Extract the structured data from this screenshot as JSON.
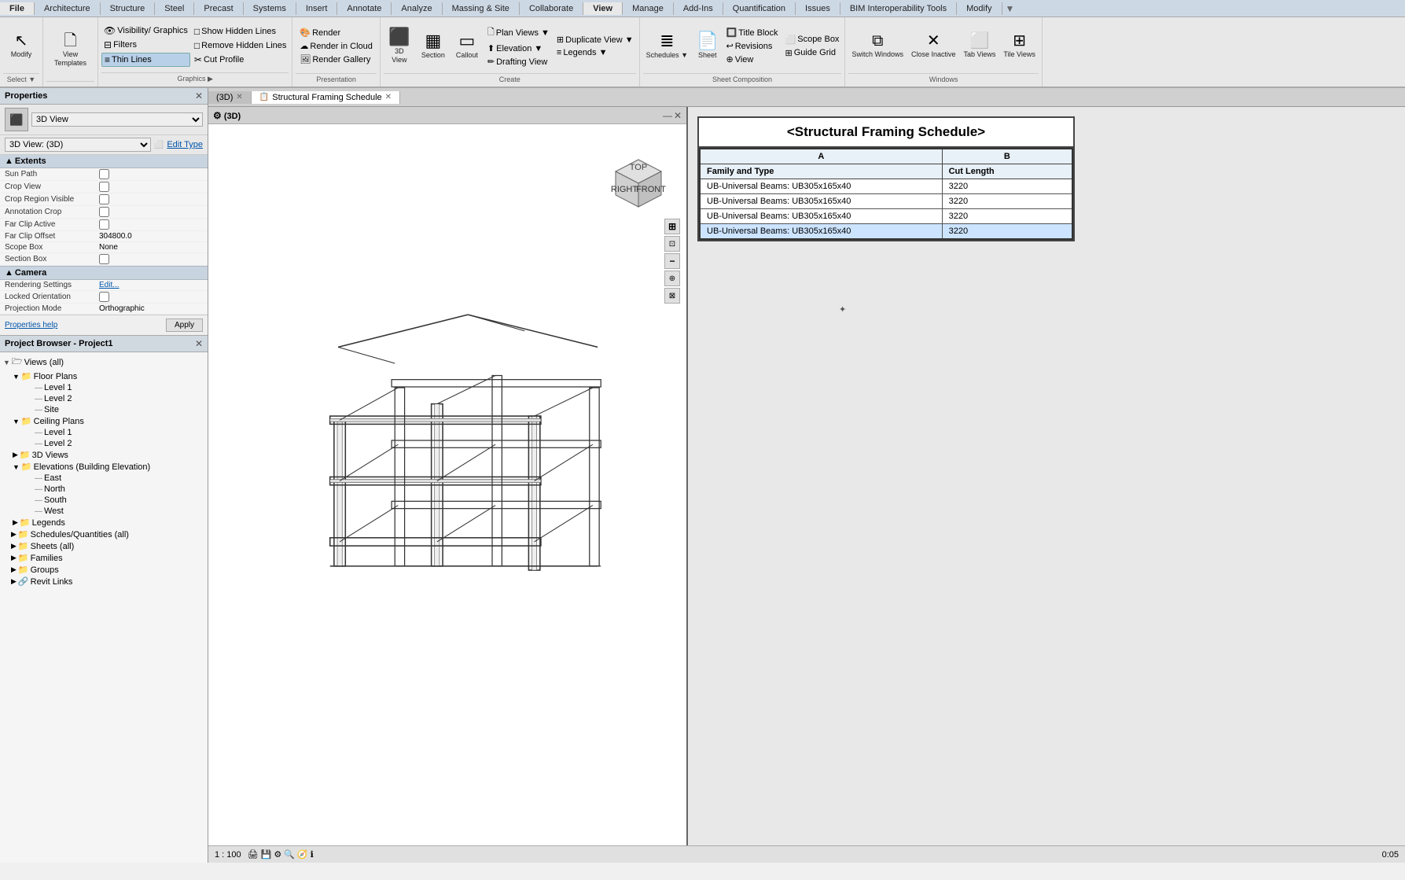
{
  "ribbon": {
    "tabs": [
      "File",
      "Architecture",
      "Structure",
      "Steel",
      "Precast",
      "Systems",
      "Insert",
      "Annotate",
      "Analyze",
      "Massing & Site",
      "Collaborate",
      "View",
      "Manage",
      "Add-Ins",
      "Quantification",
      "Issues",
      "BIM Interoperability Tools",
      "Modify"
    ],
    "active_tab": "View",
    "groups": {
      "graphics": {
        "label": "Graphics",
        "buttons": [
          {
            "id": "visibility-graphics",
            "icon": "👁",
            "label": "Visibility/\nGraphics"
          },
          {
            "id": "filters",
            "icon": "⊟",
            "label": "Filters"
          },
          {
            "id": "thin-lines",
            "icon": "⟺",
            "label": "Thin Lines"
          },
          {
            "id": "show-hidden",
            "icon": "□",
            "label": "Show Hidden Lines"
          },
          {
            "id": "remove-hidden",
            "icon": "□",
            "label": "Remove Hidden Lines"
          },
          {
            "id": "cut-profile",
            "icon": "✂",
            "label": "Cut Profile"
          }
        ]
      },
      "presentation": {
        "label": "Presentation",
        "buttons": [
          {
            "id": "render",
            "icon": "🎨",
            "label": "Render"
          },
          {
            "id": "render-cloud",
            "icon": "☁",
            "label": "Render in Cloud"
          },
          {
            "id": "render-gallery",
            "icon": "🖼",
            "label": "Render Gallery"
          }
        ]
      },
      "create": {
        "label": "Create",
        "buttons": [
          {
            "id": "3d-view",
            "icon": "⬛",
            "label": "3D\nView"
          },
          {
            "id": "section",
            "icon": "▦",
            "label": "Section"
          },
          {
            "id": "callout",
            "icon": "▭",
            "label": "Callout"
          },
          {
            "id": "plan-views",
            "icon": "🗋",
            "label": "Plan Views"
          },
          {
            "id": "elevation",
            "icon": "⬆",
            "label": "Elevation"
          },
          {
            "id": "drafting-view",
            "icon": "✏",
            "label": "Drafting View"
          },
          {
            "id": "duplicate-view",
            "icon": "⊞",
            "label": "Duplicate View"
          },
          {
            "id": "legends",
            "icon": "≡",
            "label": "Legends"
          }
        ]
      },
      "sheet-composition": {
        "label": "Sheet Composition",
        "buttons": [
          {
            "id": "schedules",
            "icon": "≣",
            "label": "Schedules"
          },
          {
            "id": "sheet",
            "icon": "📄",
            "label": "Sheet"
          },
          {
            "id": "title-block",
            "icon": "🔲",
            "label": "Title\nBlock"
          },
          {
            "id": "revisions",
            "icon": "↩",
            "label": "Revisions"
          },
          {
            "id": "view-reference",
            "icon": "⊕",
            "label": "View"
          },
          {
            "id": "guide-grid",
            "icon": "⊞",
            "label": "Guide Grid"
          },
          {
            "id": "scope-box",
            "icon": "⬜",
            "label": "Scope Box"
          }
        ]
      },
      "windows": {
        "label": "Windows",
        "buttons": [
          {
            "id": "switch-windows",
            "icon": "⧉",
            "label": "Switch Windows"
          },
          {
            "id": "close-inactive",
            "icon": "✕",
            "label": "Close Inactive"
          },
          {
            "id": "tab-views",
            "icon": "⬜",
            "label": "Tab Views"
          },
          {
            "id": "tile-views",
            "icon": "⊞",
            "label": "Tile Views"
          }
        ]
      }
    }
  },
  "properties_panel": {
    "title": "Properties",
    "view_type": "3D View",
    "view_name": "3D View: (3D)",
    "edit_type_label": "Edit Type",
    "sections": {
      "extents": {
        "label": "Extents",
        "properties": [
          {
            "label": "Sun Path",
            "value": "",
            "type": "checkbox",
            "checked": false
          },
          {
            "label": "Crop View",
            "value": "",
            "type": "checkbox",
            "checked": false
          },
          {
            "label": "Crop Region Visible",
            "value": "",
            "type": "checkbox",
            "checked": false
          },
          {
            "label": "Annotation Crop",
            "value": "",
            "type": "checkbox",
            "checked": false
          },
          {
            "label": "Far Clip Active",
            "value": "",
            "type": "checkbox",
            "checked": false
          },
          {
            "label": "Far Clip Offset",
            "value": "304800.0"
          },
          {
            "label": "Scope Box",
            "value": "None"
          },
          {
            "label": "Section Box",
            "value": "",
            "type": "checkbox",
            "checked": false
          }
        ]
      },
      "camera": {
        "label": "Camera",
        "properties": [
          {
            "label": "Rendering Settings",
            "value": "Edit...",
            "type": "link"
          },
          {
            "label": "Locked Orientation",
            "value": "",
            "type": "checkbox",
            "checked": false
          },
          {
            "label": "Projection Mode",
            "value": "Orthographic"
          }
        ]
      }
    },
    "properties_help": "Properties help",
    "apply_label": "Apply"
  },
  "project_browser": {
    "title": "Project Browser - Project1",
    "tree": [
      {
        "label": "Views (all)",
        "level": 0,
        "type": "folder",
        "expanded": true
      },
      {
        "label": "Floor Plans",
        "level": 1,
        "type": "folder",
        "expanded": true
      },
      {
        "label": "Level 1",
        "level": 2,
        "type": "view"
      },
      {
        "label": "Level 2",
        "level": 2,
        "type": "view"
      },
      {
        "label": "Site",
        "level": 2,
        "type": "view"
      },
      {
        "label": "Ceiling Plans",
        "level": 1,
        "type": "folder",
        "expanded": true
      },
      {
        "label": "Level 1",
        "level": 2,
        "type": "view"
      },
      {
        "label": "Level 2",
        "level": 2,
        "type": "view"
      },
      {
        "label": "3D Views",
        "level": 1,
        "type": "folder",
        "expanded": false
      },
      {
        "label": "Elevations (Building Elevation)",
        "level": 1,
        "type": "folder",
        "expanded": true
      },
      {
        "label": "East",
        "level": 2,
        "type": "view"
      },
      {
        "label": "North",
        "level": 2,
        "type": "view"
      },
      {
        "label": "South",
        "level": 2,
        "type": "view"
      },
      {
        "label": "West",
        "level": 2,
        "type": "view"
      },
      {
        "label": "Legends",
        "level": 1,
        "type": "folder",
        "expanded": false
      },
      {
        "label": "Schedules/Quantities (all)",
        "level": 1,
        "type": "folder",
        "expanded": false
      },
      {
        "label": "Sheets (all)",
        "level": 1,
        "type": "folder",
        "expanded": false
      },
      {
        "label": "Families",
        "level": 1,
        "type": "folder",
        "expanded": false
      },
      {
        "label": "Groups",
        "level": 1,
        "type": "folder",
        "expanded": false
      },
      {
        "label": "Revit Links",
        "level": 1,
        "type": "folder",
        "expanded": false
      }
    ]
  },
  "view_3d": {
    "title": "(3D)",
    "scale": "1 : 100"
  },
  "schedule": {
    "tab_label": "Structural Framing Schedule",
    "title": "<Structural Framing Schedule>",
    "columns": [
      {
        "id": "A",
        "header": "A",
        "sub_header": "Family and Type"
      },
      {
        "id": "B",
        "header": "B",
        "sub_header": "Cut Length"
      }
    ],
    "rows": [
      {
        "family_type": "UB-Universal Beams: UB305x165x40",
        "cut_length": "3220",
        "selected": false
      },
      {
        "family_type": "UB-Universal Beams: UB305x165x40",
        "cut_length": "3220",
        "selected": false
      },
      {
        "family_type": "UB-Universal Beams: UB305x165x40",
        "cut_length": "3220",
        "selected": false
      },
      {
        "family_type": "UB-Universal Beams: UB305x165x40",
        "cut_length": "3220",
        "selected": true
      }
    ]
  },
  "status_bar": {
    "scale": "1 : 100",
    "time": "0:05"
  },
  "icons": {
    "expand": "▼",
    "collapse": "▶",
    "folder": "📁",
    "view": "🗋",
    "close": "✕",
    "search": "🔍",
    "settings": "⚙",
    "nav_cube": "⬡"
  }
}
